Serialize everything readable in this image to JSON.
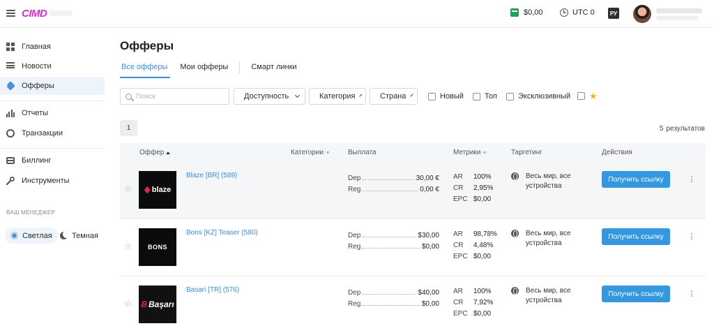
{
  "header": {
    "logo": "CIMD",
    "balance": "$0,00",
    "timezone": "UTC 0",
    "language": "РУ"
  },
  "sidebar": {
    "items": [
      {
        "label": "Главная",
        "icon": "dashboard-icon"
      },
      {
        "label": "Новости",
        "icon": "news-icon"
      },
      {
        "label": "Офферы",
        "icon": "tag-icon"
      },
      {
        "label": "Отчеты",
        "icon": "bar-chart-icon"
      },
      {
        "label": "Транзакции",
        "icon": "transactions-icon"
      },
      {
        "label": "Биллинг",
        "icon": "credit-card-icon"
      },
      {
        "label": "Инструменты",
        "icon": "wrench-icon"
      }
    ],
    "manager_label": "ВАШ МЕНЕДЖЕР",
    "theme_light": "Светлая",
    "theme_dark": "Темная"
  },
  "page": {
    "title": "Офферы",
    "tabs": [
      "Все офферы",
      "Мои офферы",
      "Смарт линки"
    ]
  },
  "filters": {
    "search_placeholder": "Поиск",
    "availability": "Доступность",
    "category": "Категория",
    "country": "Страна",
    "new": "Новый",
    "top": "Топ",
    "exclusive": "Эксклюзивный"
  },
  "pagination": {
    "page": "1",
    "results_count": "5",
    "results_label": "результатов"
  },
  "table": {
    "columns": [
      "Оффер",
      "Категории",
      "Выплата",
      "Метрики",
      "Таргетинг",
      "Действия"
    ],
    "rows": [
      {
        "name": "Blaze [BR] (589)",
        "logo": "blaze",
        "dep_label": "Dep",
        "dep": "30,00 €",
        "reg_label": "Reg",
        "reg": "0,00 €",
        "ar_label": "AR",
        "ar": "100%",
        "cr_label": "CR",
        "cr": "2,95%",
        "epc_label": "EPC",
        "epc": "$0,00",
        "targeting": "Весь мир, все устройства",
        "action": "Получить ссылку"
      },
      {
        "name": "Bons [KZ] Teaser (580)",
        "logo": "BONS",
        "dep_label": "Dep",
        "dep": "$30,00",
        "reg_label": "Reg",
        "reg": "$0,00",
        "ar_label": "AR",
        "ar": "98,78%",
        "cr_label": "CR",
        "cr": "4,48%",
        "epc_label": "EPC",
        "epc": "$0,00",
        "targeting": "Весь мир, все устройства",
        "action": "Получить ссылку"
      },
      {
        "name": "Basari [TR] (576)",
        "logo": "Başarı",
        "dep_label": "Dep",
        "dep": "$40,00",
        "reg_label": "Reg",
        "reg": "$0,00",
        "ar_label": "AR",
        "ar": "100%",
        "cr_label": "CR",
        "cr": "7,92%",
        "epc_label": "EPC",
        "epc": "$0,00",
        "targeting": "Весь мир, все устройства",
        "action": "Получить ссылку"
      }
    ]
  },
  "colors": {
    "accent": "#3398e0",
    "link": "#3a8ddc",
    "brand": "#d62ad0",
    "wallet": "#22a053"
  }
}
